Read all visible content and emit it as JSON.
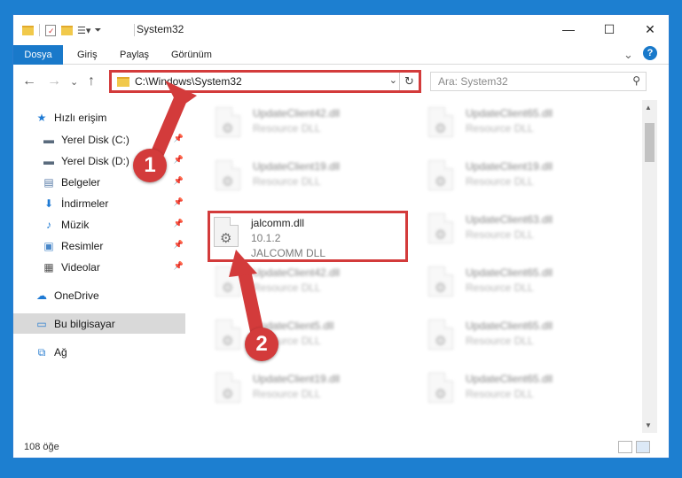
{
  "window": {
    "title": "System32",
    "minimize_label": "—",
    "maximize_label": "☐",
    "close_label": "✕"
  },
  "ribbon": {
    "tabs": [
      "Dosya",
      "Giriş",
      "Paylaş",
      "Görünüm"
    ],
    "help": "?",
    "expand": "⌄"
  },
  "nav": {
    "back": "←",
    "forward": "→",
    "recent": "⌄",
    "up": "↑",
    "address_path": "C:\\Windows\\System32",
    "search_placeholder": "Ara: System32"
  },
  "sidebar": {
    "items": [
      {
        "label": "Hızlı erişim",
        "icon": "star-icon",
        "pinned": false
      },
      {
        "label": "Yerel Disk (C:)",
        "icon": "drive-icon",
        "pinned": true
      },
      {
        "label": "Yerel Disk (D:)",
        "icon": "drive-icon",
        "pinned": true
      },
      {
        "label": "Belgeler",
        "icon": "documents-icon",
        "pinned": true
      },
      {
        "label": "İndirmeler",
        "icon": "downloads-icon",
        "pinned": true
      },
      {
        "label": "Müzik",
        "icon": "music-icon",
        "pinned": true
      },
      {
        "label": "Resimler",
        "icon": "pictures-icon",
        "pinned": true
      },
      {
        "label": "Videolar",
        "icon": "videos-icon",
        "pinned": true
      },
      {
        "label": "OneDrive",
        "icon": "cloud-icon",
        "pinned": false
      },
      {
        "label": "Bu bilgisayar",
        "icon": "computer-icon",
        "pinned": false,
        "selected": true
      },
      {
        "label": "Ağ",
        "icon": "network-icon",
        "pinned": false
      }
    ]
  },
  "files": {
    "left_column": [
      {
        "name": "UpdateClient42.dll",
        "line2": "Resource DLL",
        "line3": ""
      },
      {
        "name": "UpdateClient19.dll",
        "line2": "Resource DLL",
        "line3": ""
      },
      {
        "name": "jalcomm.dll",
        "line2": "10.1.2",
        "line3": "JALCOMM DLL"
      },
      {
        "name": "UpdateClient42.dll",
        "line2": "Resource DLL",
        "line3": ""
      },
      {
        "name": "UpdateClient5.dll",
        "line2": "Resource DLL",
        "line3": ""
      },
      {
        "name": "UpdateClient19.dll",
        "line2": "Resource DLL",
        "line3": ""
      }
    ],
    "right_column": [
      {
        "name": "UpdateClient65.dll",
        "line2": "Resource DLL"
      },
      {
        "name": "UpdateClient19.dll",
        "line2": "Resource DLL"
      },
      {
        "name": "UpdateClient63.dll",
        "line2": "Resource DLL"
      },
      {
        "name": "UpdateClient65.dll",
        "line2": "Resource DLL"
      },
      {
        "name": "UpdateClient65.dll",
        "line2": "Resource DLL"
      },
      {
        "name": "UpdateClient65.dll",
        "line2": "Resource DLL"
      }
    ]
  },
  "status": {
    "item_count": "108 öğe"
  },
  "annotations": {
    "step1": "1",
    "step2": "2",
    "color": "#d33b3b"
  }
}
